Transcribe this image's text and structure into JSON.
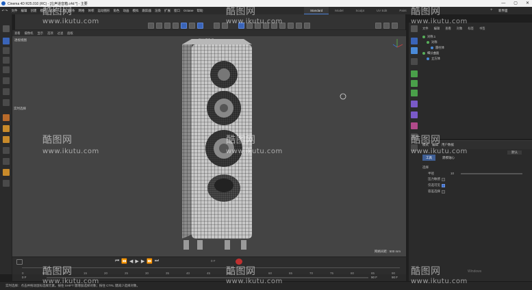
{
  "window": {
    "title": "Cinema 4D R25.010 (RC) - [左声道音箱.c4d *] - 主要",
    "min_icon": "minimize-icon",
    "max_icon": "maximize-icon",
    "close_icon": "close-icon"
  },
  "menubar": {
    "items": [
      "文件",
      "编辑",
      "创建",
      "模式",
      "选择",
      "工具",
      "样条",
      "网格",
      "体积",
      "运动图形",
      "角色",
      "动画",
      "模拟",
      "跟踪器",
      "渲染",
      "扩展",
      "窗口",
      "Octane",
      "帮助"
    ],
    "layouts": [
      "Standard",
      "Model",
      "Sculpt",
      "UV Edit",
      "Paint"
    ],
    "active_layout": "Standard",
    "new_ui_label": "新界面"
  },
  "toolbar": {
    "icons": [
      "undo-icon",
      "redo-icon",
      "object-mode-icon",
      "point-mode-icon",
      "edge-mode-icon",
      "poly-mode-icon",
      "model-mode-icon",
      "texture-mode-icon",
      "axis-icon",
      "snap-icon",
      "keyframe-icon",
      "autokey-icon",
      "cube-icon",
      "pen-icon",
      "subdivision-icon",
      "extrude-icon",
      "deformer-icon",
      "field-icon",
      "environment-icon",
      "camera-icon",
      "light-icon",
      "render-view-icon",
      "render-icon",
      "render-settings-icon"
    ]
  },
  "viewport": {
    "menu": [
      "查看",
      "摄像机",
      "显示",
      "选项",
      "过滤",
      "面板"
    ],
    "view_label": "透视视图",
    "camera_label": "默认摄像机 ⟳●",
    "realtime_label": "实时选择",
    "grid_spacing": "网格间距 : 500 mm"
  },
  "timeline": {
    "ticks": [
      "0",
      "5",
      "10",
      "15",
      "20",
      "25",
      "30",
      "35",
      "40",
      "45",
      "50",
      "55",
      "60",
      "65",
      "70",
      "75",
      "80",
      "85",
      "90"
    ],
    "current_frame": "0 F",
    "start_frame": "0 F",
    "end_frame": "90 F",
    "end_frame2": "90 F"
  },
  "status": {
    "text": "实时选择：点击并拖动鼠标选择元素。按住 SHIFT 键增加选择对象；按住 CTRL 键减少选择对象。"
  },
  "objects": {
    "menu": [
      "文件",
      "编辑",
      "查看",
      "对象",
      "标签",
      "书签"
    ],
    "rows": [
      {
        "name": "对称.1",
        "indent": 0
      },
      {
        "name": "对称",
        "indent": 1
      },
      {
        "name": "圆柱体",
        "indent": 2
      },
      {
        "name": "细分曲面",
        "indent": 0
      },
      {
        "name": "立方体",
        "indent": 1
      }
    ]
  },
  "attributes": {
    "mode_menu": [
      "模式",
      "编辑",
      "用户数据"
    ],
    "preset": "默认",
    "tabs": [
      "工具",
      "建模轴心"
    ],
    "active_tab": "工具",
    "section": "选择",
    "fields": [
      {
        "label": "半径",
        "value": "10"
      },
      {
        "label": "压力敏感",
        "checked": false
      },
      {
        "label": "仅选可见",
        "checked": true
      },
      {
        "label": "容差选择",
        "checked": false
      }
    ]
  },
  "overlay": {
    "activate_windows": "Windows"
  },
  "watermark": {
    "brand": "酷图网",
    "url": "www.ikutu.com"
  },
  "accent_color": "#3a64b8"
}
